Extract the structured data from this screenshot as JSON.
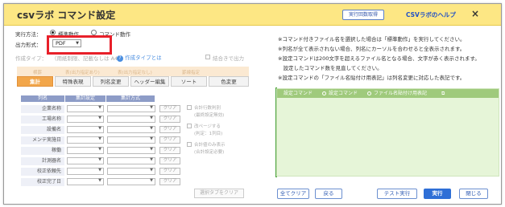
{
  "window": {
    "title": "csvラボ コマンド設定",
    "history_button": "実行回数取得",
    "help_link": "CSVラボのヘルプ",
    "close_icon": "×"
  },
  "exec_method": {
    "label": "実行方法：",
    "options": [
      "標準動作",
      "コマンド動作"
    ],
    "selected": "標準動作"
  },
  "output_format": {
    "label": "出力形式：",
    "value": "PDF",
    "highlight_color": "#e8202a"
  },
  "create_type": {
    "label": "作成タイプ：",
    "note": "（用紙制限、記載なしは A4）",
    "help_text": "作成タイプとは",
    "merge_output": "結合きで出力"
  },
  "faded_tabs": [
    "横罫",
    "表(出力指定あり)",
    "表(出力指定なし)",
    "罫線指定"
  ],
  "tabs": [
    "集計",
    "特殊表現",
    "列名変更",
    "ヘッダー編集",
    "ソート",
    "色変更"
  ],
  "active_tab": "集計",
  "grid": {
    "headers": [
      "列名",
      "集計設定",
      "集計方式"
    ],
    "rows": [
      "企業名称",
      "工場名称",
      "設備名",
      "メンテ実施日",
      "稼働",
      "計測器名",
      "校正依頼先",
      "校正完了日"
    ],
    "clear_label": "クリア"
  },
  "side_options": [
    {
      "label": "合計行数判別",
      "sub": "(最終設定無効)"
    },
    {
      "label": "改ページする",
      "sub": "(判定：1列目)"
    },
    {
      "label": "合計値のみ表示",
      "sub": "(合計設定必要)"
    }
  ],
  "clear_selection": "選択タブをクリア",
  "notes": [
    "※コマンド付きファイル名を選択した場合は「標準動作」を実行してください。",
    "※列名が全て表示されない場合、列名にカーソルを合わせると全表示されます。",
    "※設定コマンドは200文字を超えるファイル名となる場合、文字が赤く表示されます。",
    "　設定したコマンド数を見直してください。",
    "※設定コマンドの「ファイル名貼付け用表記」は列名変更に対応した表記です。"
  ],
  "command_panel": {
    "header": "設定コマンド",
    "radio1": "設定コマンド",
    "radio2": "ファイル名貼付け用表記",
    "copy_icon": "copy-icon"
  },
  "footer": {
    "clear_all": "全てクリア",
    "back": "戻る",
    "test_run": "テスト実行",
    "run": "実行",
    "close": "閉じる"
  },
  "colors": {
    "titlebar": "#fde784",
    "active_tab": "#f2a64a",
    "grid_header": "#8d9cc7",
    "command_panel": "#e6f5d8",
    "primary": "#2f6fd6"
  }
}
